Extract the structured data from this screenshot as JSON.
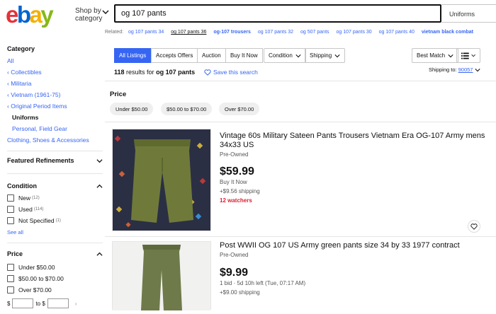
{
  "header": {
    "logo": {
      "e": "e",
      "b": "b",
      "a": "a",
      "y": "y"
    },
    "shop_by_line1": "Shop by",
    "shop_by_line2": "category",
    "search_value": "og 107 pants",
    "category_select": "Uniforms"
  },
  "related": {
    "label": "Related:",
    "items": [
      "og 107 pants 34",
      "og 107 pants 36",
      "og-107 trousers",
      "og 107 pants 32",
      "og 507 pants",
      "og 107 pants 30",
      "og 107 pants 40",
      "vietnam black combat"
    ]
  },
  "sidebar": {
    "category_title": "Category",
    "categories": [
      "All",
      "Collectibles",
      "Militaria",
      "Vietnam (1961-75)",
      "Original Period Items",
      "Uniforms",
      "Personal, Field Gear",
      "Clothing, Shoes & Accessories"
    ],
    "featured_title": "Featured Refinements",
    "condition_title": "Condition",
    "conditions": [
      {
        "label": "New",
        "count": "(12)"
      },
      {
        "label": "Used",
        "count": "(114)"
      },
      {
        "label": "Not Specified",
        "count": "(1)"
      }
    ],
    "see_all": "See all",
    "price_title": "Price",
    "prices": [
      "Under $50.00",
      "$50.00 to $70.00",
      "Over $70.00"
    ],
    "price_from_symbol": "$",
    "price_to": "to $"
  },
  "toolbar": {
    "tabs": [
      "All Listings",
      "Accepts Offers",
      "Auction",
      "Buy It Now"
    ],
    "condition_dd": "Condition",
    "shipping_dd": "Shipping",
    "sort_dd": "Best Match",
    "results_count": "118",
    "results_text": "results for",
    "results_query": "og 107 pants",
    "save_search": "Save this search",
    "ship_to_label": "Shipping to:",
    "ship_to_zip": "90057"
  },
  "price_filter": {
    "title": "Price",
    "pills": [
      "Under $50.00",
      "$50.00 to $70.00",
      "Over $70.00"
    ]
  },
  "items": [
    {
      "title": "Vintage 60s Military Sateen Pants Trousers Vietnam Era OG-107 Army mens 34x33 US",
      "condition": "Pre-Owned",
      "price": "$59.99",
      "format": "Buy It Now",
      "shipping": "+$9.56 shipping",
      "watchers": "12 watchers"
    },
    {
      "title": "Post WWII OG 107 US Army green pants size 34 by 33 1977 contract",
      "condition": "Pre-Owned",
      "price": "$9.99",
      "format": "1 bid · 5d 10h left (Tue, 07:17 AM)",
      "shipping": "+$9.00 shipping"
    }
  ],
  "colors": {
    "link": "#3665f3",
    "logo_e": "#e53238",
    "logo_b": "#0064d2",
    "logo_a": "#f5af02",
    "logo_y": "#86b817",
    "watch": "#dd1e31"
  }
}
